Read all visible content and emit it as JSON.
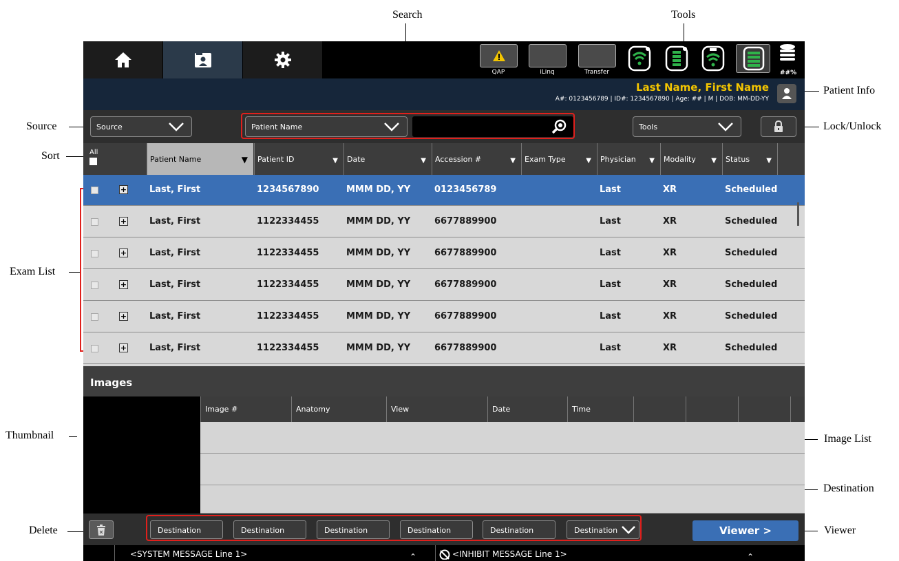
{
  "callouts": {
    "search": "Search",
    "tools": "Tools",
    "patient_info": "Patient Info",
    "source": "Source",
    "lock_unlock": "Lock/Unlock",
    "sort": "Sort",
    "exam_list": "Exam List",
    "thumbnail": "Thumbnail",
    "image_list": "Image List",
    "destination": "Destination",
    "delete": "Delete",
    "viewer": "Viewer"
  },
  "topbar": {
    "tools": [
      {
        "label": "QAP",
        "icon": "warning-icon"
      },
      {
        "label": "iLinq",
        "icon": ""
      },
      {
        "label": "Transfer",
        "icon": ""
      }
    ],
    "status_icons": [
      "wifi-detector-icon",
      "battery-detector-icon",
      "wifi-detector-icon",
      "battery-icon",
      "storage-icon"
    ],
    "storage_label": "##%"
  },
  "patient": {
    "name": "Last Name, First Name",
    "details": "A#: 0123456789 | ID#: 1234567890 | Age: ## | M | DOB: MM-DD-YY"
  },
  "filters": {
    "source": "Source",
    "search_field": "Patient Name",
    "search_value": "",
    "tools": "Tools"
  },
  "table": {
    "all_label": "All",
    "columns": [
      "Patient Name",
      "Patient ID",
      "Date",
      "Accession #",
      "Exam Type",
      "Physician",
      "Modality",
      "Status"
    ],
    "rows": [
      {
        "name": "Last, First",
        "id": "1234567890",
        "date": "MMM DD, YY",
        "accession": "0123456789",
        "exam_type": "",
        "physician": "Last",
        "modality": "XR",
        "status": "Scheduled",
        "selected": true
      },
      {
        "name": "Last, First",
        "id": "1122334455",
        "date": "MMM DD, YY",
        "accession": "6677889900",
        "exam_type": "",
        "physician": "Last",
        "modality": "XR",
        "status": "Scheduled",
        "selected": false
      },
      {
        "name": "Last, First",
        "id": "1122334455",
        "date": "MMM DD, YY",
        "accession": "6677889900",
        "exam_type": "",
        "physician": "Last",
        "modality": "XR",
        "status": "Scheduled",
        "selected": false
      },
      {
        "name": "Last, First",
        "id": "1122334455",
        "date": "MMM DD, YY",
        "accession": "6677889900",
        "exam_type": "",
        "physician": "Last",
        "modality": "XR",
        "status": "Scheduled",
        "selected": false
      },
      {
        "name": "Last, First",
        "id": "1122334455",
        "date": "MMM DD, YY",
        "accession": "6677889900",
        "exam_type": "",
        "physician": "Last",
        "modality": "XR",
        "status": "Scheduled",
        "selected": false
      },
      {
        "name": "Last, First",
        "id": "1122334455",
        "date": "MMM DD, YY",
        "accession": "6677889900",
        "exam_type": "",
        "physician": "Last",
        "modality": "XR",
        "status": "Scheduled",
        "selected": false
      }
    ]
  },
  "images": {
    "title": "Images",
    "columns": [
      "Image #",
      "Anatomy",
      "View",
      "Date",
      "Time"
    ]
  },
  "bottom": {
    "destinations": [
      "Destination",
      "Destination",
      "Destination",
      "Destination",
      "Destination",
      "Destination"
    ],
    "viewer": "Viewer >"
  },
  "messages": {
    "system": "<SYSTEM MESSAGE Line 1>",
    "inhibit": "<INHIBIT MESSAGE Line 1>"
  },
  "colors": {
    "selected_row": "#3a6fb5",
    "patient_name": "#f3c500",
    "callout_red": "#e0201c",
    "ok_green": "#2fb34a"
  }
}
